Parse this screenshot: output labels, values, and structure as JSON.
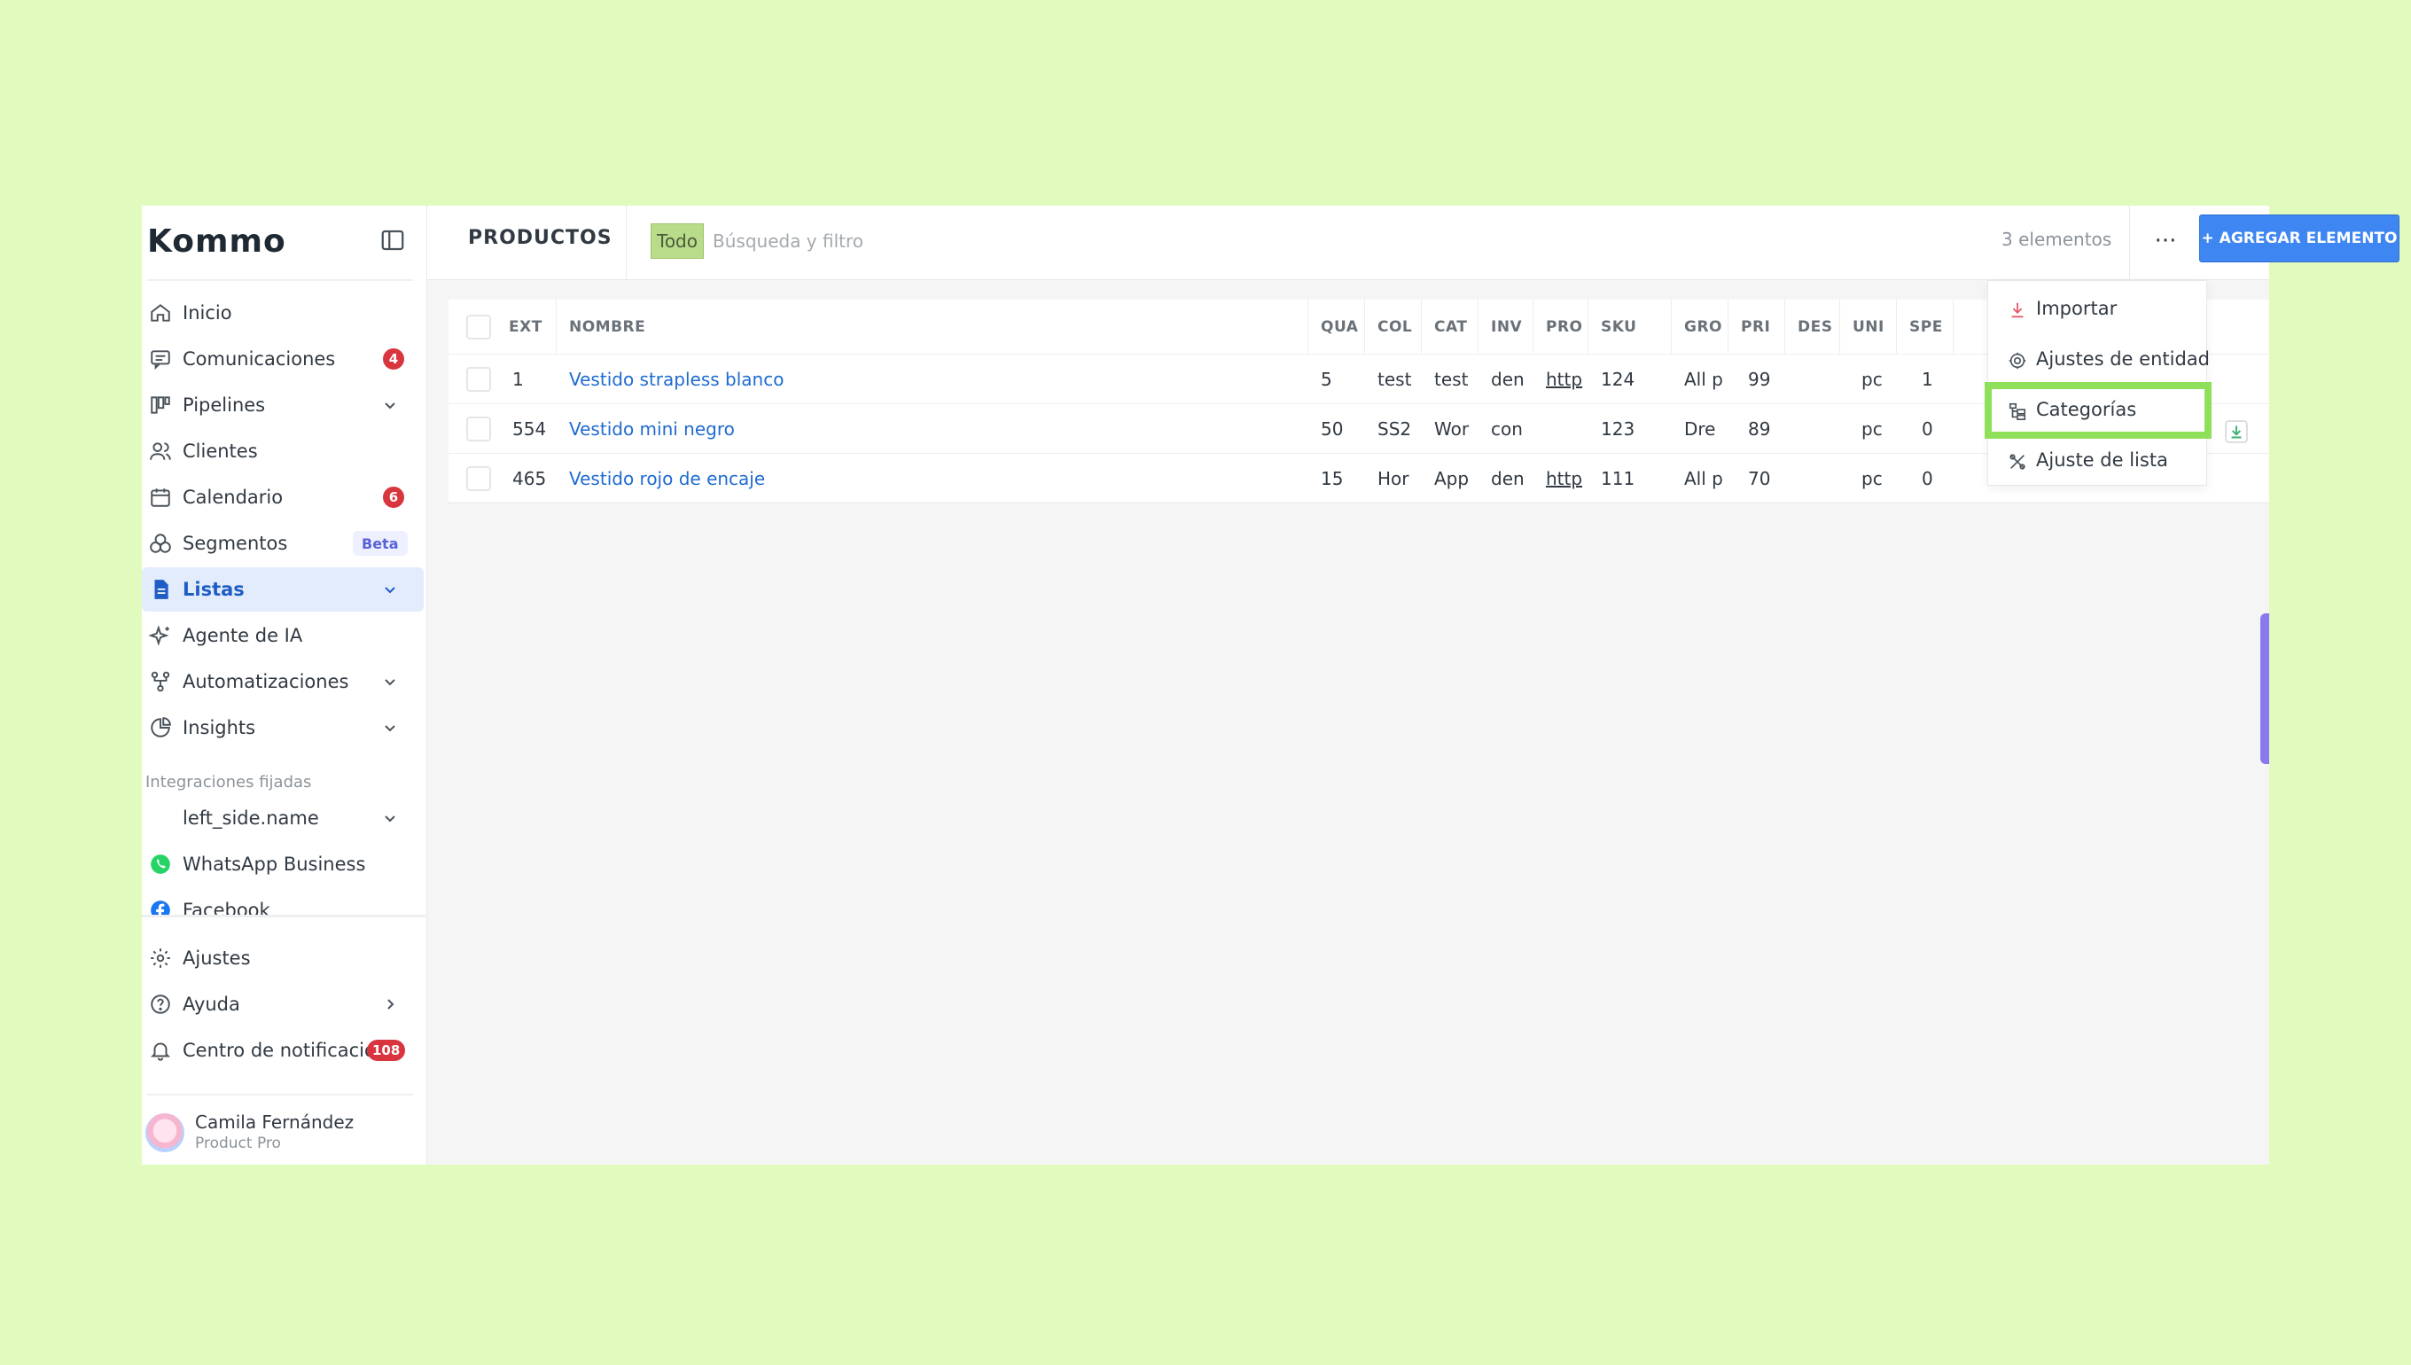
{
  "brand": {
    "logo_text": "Kommo"
  },
  "sidebar": {
    "nav": [
      {
        "label": "Inicio",
        "icon": "home-icon"
      },
      {
        "label": "Comunicaciones",
        "icon": "chat-icon",
        "badge": "4"
      },
      {
        "label": "Pipelines",
        "icon": "pipeline-icon"
      },
      {
        "label": "Clientes",
        "icon": "users-icon"
      },
      {
        "label": "Calendario",
        "icon": "calendar-icon",
        "badge": "6"
      },
      {
        "label": "Segmentos",
        "icon": "segments-icon",
        "tag": "Beta"
      },
      {
        "label": "Listas",
        "icon": "lists-icon",
        "active": true
      },
      {
        "label": "Agente de IA",
        "icon": "sparkle-icon"
      },
      {
        "label": "Automatizaciones",
        "icon": "automation-icon"
      },
      {
        "label": "Insights",
        "icon": "chart-pie-icon"
      }
    ],
    "pinned_label": "Integraciones fijadas",
    "pinned": [
      {
        "label": "left_side.name"
      },
      {
        "label": "WhatsApp Business",
        "icon": "whatsapp-icon"
      },
      {
        "label": "Facebook",
        "icon": "facebook-icon"
      }
    ],
    "bottom": [
      {
        "label": "Ajustes",
        "icon": "gear-icon"
      },
      {
        "label": "Ayuda",
        "icon": "help-icon"
      },
      {
        "label": "Centro de notificacio...",
        "icon": "bell-icon",
        "badge": "108"
      }
    ],
    "user": {
      "name": "Camila Fernández",
      "role": "Product Pro"
    }
  },
  "header": {
    "title": "PRODUCTOS",
    "filter_tag": "Todo",
    "search_placeholder": "Búsqueda y filtro",
    "count": "3 elementos",
    "more_label": "···",
    "add_button": "+ AGREGAR ELEMENTO"
  },
  "table": {
    "columns": [
      "EXT",
      "NOMBRE",
      "QUA",
      "COL",
      "CAT",
      "INV",
      "PRO",
      "SKU",
      "GRO",
      "PRI",
      "DES",
      "UNI",
      "SPE"
    ],
    "rows": [
      [
        "1",
        "Vestido strapless blanco",
        "5",
        "test",
        "test",
        "den",
        "http",
        "124",
        "All p",
        "99",
        "",
        "pc",
        "1"
      ],
      [
        "554",
        "Vestido mini negro",
        "50",
        "SS2",
        "Wor",
        "con",
        "",
        "123",
        "Dre",
        "89",
        "",
        "pc",
        "0"
      ],
      [
        "465",
        "Vestido rojo de encaje",
        "15",
        "Hor",
        "App",
        "den",
        "http",
        "111",
        "All p",
        "70",
        "",
        "pc",
        "0"
      ]
    ]
  },
  "menu": {
    "items": [
      {
        "label": "Importar",
        "icon": "import-icon"
      },
      {
        "label": "Ajustes de entidad",
        "icon": "gear-icon"
      },
      {
        "label": "Categorías",
        "icon": "categories-icon",
        "highlighted": true
      },
      {
        "label": "Ajuste de lista",
        "icon": "list-settings-icon"
      }
    ]
  },
  "colors": {
    "accent": "#3e86f1",
    "badge": "#d8353e",
    "highlight": "#8ee05a",
    "background": "#e0fbbd"
  }
}
